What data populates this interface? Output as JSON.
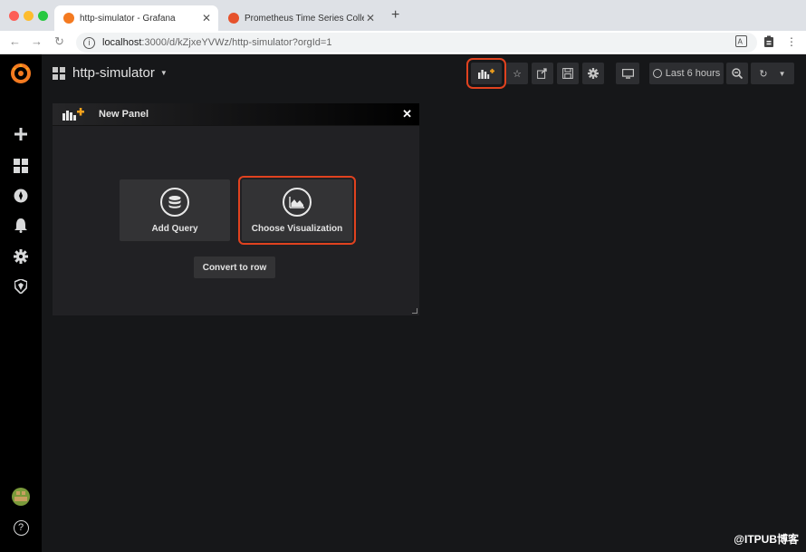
{
  "browser": {
    "tabs": [
      {
        "title": "http-simulator - Grafana",
        "active": true
      },
      {
        "title": "Prometheus Time Series Collec",
        "active": false
      }
    ],
    "url_host": "localhost",
    "url_path": ":3000/d/kZjxeYVWz/http-simulator?orgId=1"
  },
  "navbar": {
    "dashboard_title": "http-simulator",
    "time_range": "Last 6 hours"
  },
  "panel": {
    "title": "New Panel",
    "add_query": "Add Query",
    "choose_visualization": "Choose Visualization",
    "convert_to_row": "Convert to row"
  },
  "sidemenu": {
    "help": "?"
  },
  "watermark": "@ITPUB博客",
  "colors": {
    "accent_highlight": "#e0421f",
    "grafana_orange": "#f47a20",
    "app_bg": "#161719",
    "sidemenu_bg": "#000000"
  }
}
